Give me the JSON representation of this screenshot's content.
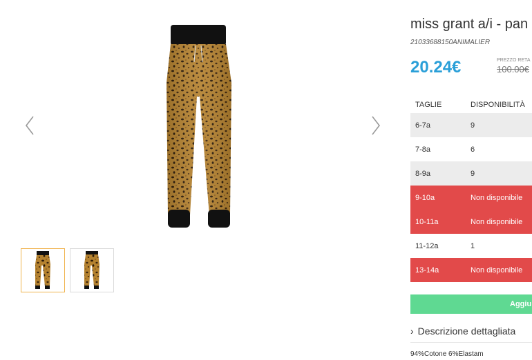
{
  "product": {
    "title": "miss grant a/i - pan",
    "sku": "21033688150ANIMALIER",
    "price": "20.24€",
    "retail_label": "PREZZO RETA",
    "retail_price": "100.00€"
  },
  "sizes_table": {
    "headers": [
      "TAGLIE",
      "DISPONIBILITÀ"
    ],
    "rows": [
      {
        "size": "6-7a",
        "availability": "9",
        "available": true
      },
      {
        "size": "7-8a",
        "availability": "6",
        "available": true
      },
      {
        "size": "8-9a",
        "availability": "9",
        "available": true
      },
      {
        "size": "9-10a",
        "availability": "Non disponibile",
        "available": false
      },
      {
        "size": "10-11a",
        "availability": "Non disponibile",
        "available": false
      },
      {
        "size": "11-12a",
        "availability": "1",
        "available": true
      },
      {
        "size": "13-14a",
        "availability": "Non disponibile",
        "available": false
      }
    ]
  },
  "add_button": "Aggiu",
  "description": {
    "heading": "Descrizione dettagliata",
    "text": "94%Cotone 6%Elastam"
  },
  "colors": {
    "price": "#2a9fd8",
    "unavailable": "#e24a4a",
    "add_button": "#5fd992",
    "thumb_active_border": "#f0b24a"
  },
  "icons": {
    "prev": "chevron-left-icon",
    "next": "chevron-right-icon",
    "desc": "chevron-right-icon"
  }
}
